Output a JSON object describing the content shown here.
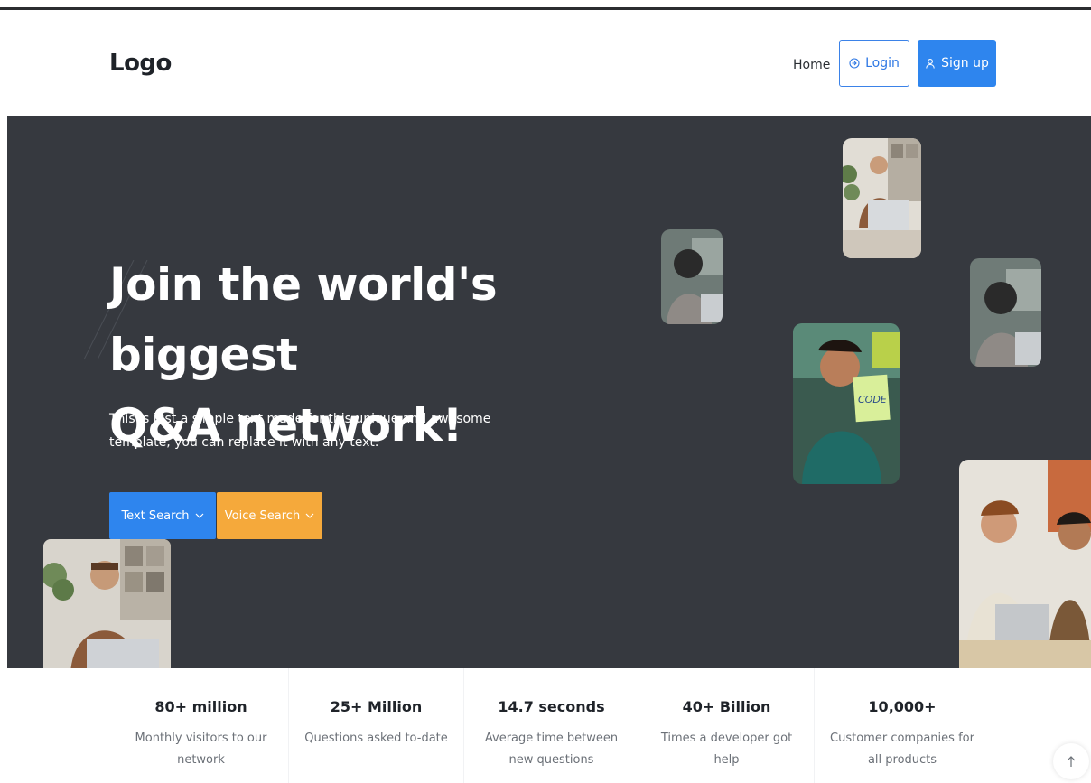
{
  "header": {
    "logo": "Logo",
    "nav_home": "Home",
    "login_label": "Login",
    "signup_label": "Sign up"
  },
  "hero": {
    "title_line1": "Join the world's biggest",
    "title_line2": "Q&A network!",
    "description": "This is just a simple text made for this unique and awesome template, you can replace it with any text.",
    "text_search_label": "Text Search",
    "voice_search_label": "Voice Search",
    "sticky_note_text": "CODE"
  },
  "stats": [
    {
      "value": "80+ million",
      "label": "Monthly visitors to our network"
    },
    {
      "value": "25+ Million",
      "label": "Questions asked to-date"
    },
    {
      "value": "14.7 seconds",
      "label": "Average time between new questions"
    },
    {
      "value": "40+ Billion",
      "label": "Times a developer got help"
    },
    {
      "value": "10,000+",
      "label": "Customer companies for all products"
    }
  ],
  "colors": {
    "primary": "#2e85ee",
    "accent": "#f5a93b",
    "hero_bg": "#36393f"
  },
  "icons": {
    "login": "login-icon",
    "signup": "user-icon",
    "dropdown": "chevron-down-icon",
    "scroll_top": "arrow-up-icon"
  }
}
